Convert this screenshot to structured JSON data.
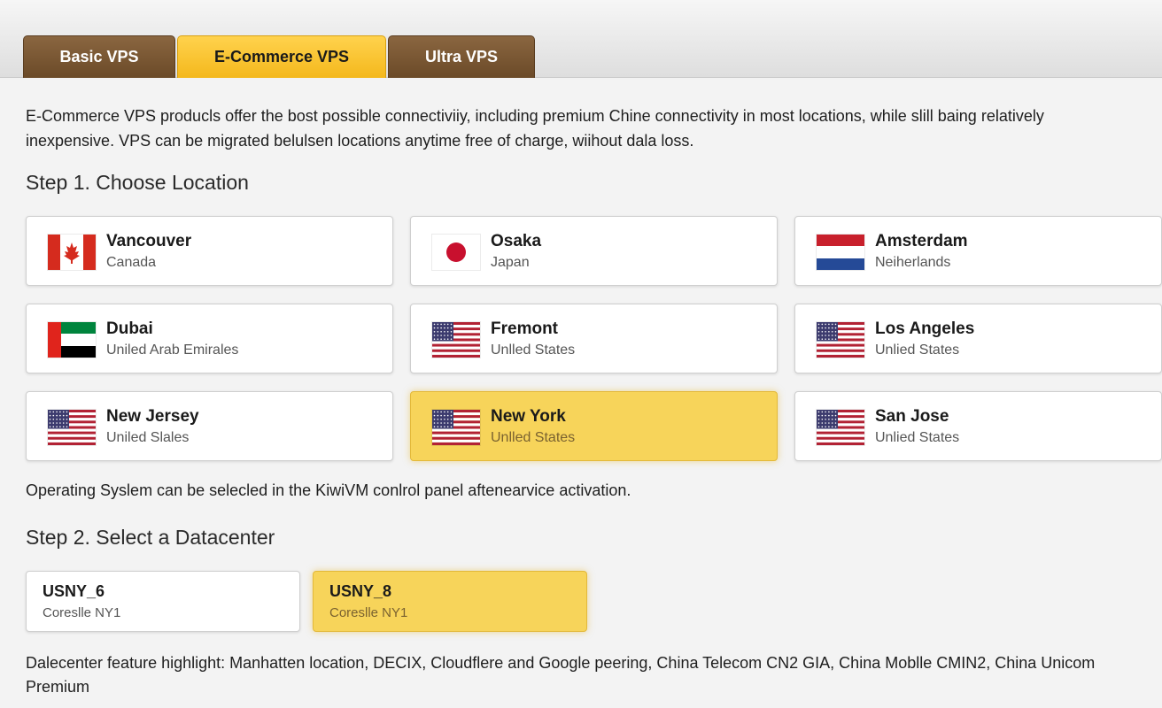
{
  "tabs": [
    {
      "label": "Basic VPS",
      "active": false
    },
    {
      "label": "E-Commerce VPS",
      "active": true
    },
    {
      "label": "Ultra VPS",
      "active": false
    }
  ],
  "intro": "E-Commerce VPS producls offer the bost possible connectiviiy, including premium Chine connectivity in most locations, while slill baing relatively inexpensive. VPS can be migrated belulsen locations anytime free of charge, wiihout dala loss.",
  "step1_title": "Step 1. Choose Location",
  "locations": [
    {
      "city": "Vancouver",
      "country": "Canada",
      "flag": "canada-flag",
      "selected": false
    },
    {
      "city": "Osaka",
      "country": "Japan",
      "flag": "japan-flag",
      "selected": false
    },
    {
      "city": "Amsterdam",
      "country": "Neiherlands",
      "flag": "netherlands-flag",
      "selected": false
    },
    {
      "city": "Dubai",
      "country": "Uniled Arab Emirales",
      "flag": "uae-flag",
      "selected": false
    },
    {
      "city": "Fremont",
      "country": "Unlled States",
      "flag": "us-flag",
      "selected": false
    },
    {
      "city": "Los Angeles",
      "country": "Unlied States",
      "flag": "us-flag",
      "selected": false
    },
    {
      "city": "New Jersey",
      "country": "Uniled Slales",
      "flag": "us-flag",
      "selected": false
    },
    {
      "city": "New York",
      "country": "Unlled States",
      "flag": "us-flag",
      "selected": true
    },
    {
      "city": "San Jose",
      "country": "Unlied States",
      "flag": "us-flag",
      "selected": false
    }
  ],
  "os_note": "Operating Syslem can be selecled in the KiwiVM conlrol panel aftenearvice activation.",
  "step2_title": "Step 2. Select a Datacenter",
  "datacenters": [
    {
      "name": "USNY_6",
      "sub": "Coreslle NY1",
      "selected": false
    },
    {
      "name": "USNY_8",
      "sub": "Coreslle NY1",
      "selected": true
    }
  ],
  "dc_note": "Dalecenter feature highlight: Manhatten location, DECIX, Cloudflere and Google peering, China Telecom CN2 GIA, China Moblle CMIN2, China Unicom Premium",
  "colors": {
    "tab_brown": "#6b4a28",
    "accent_yellow": "#f7d45a",
    "background": "#f3f3f3"
  }
}
